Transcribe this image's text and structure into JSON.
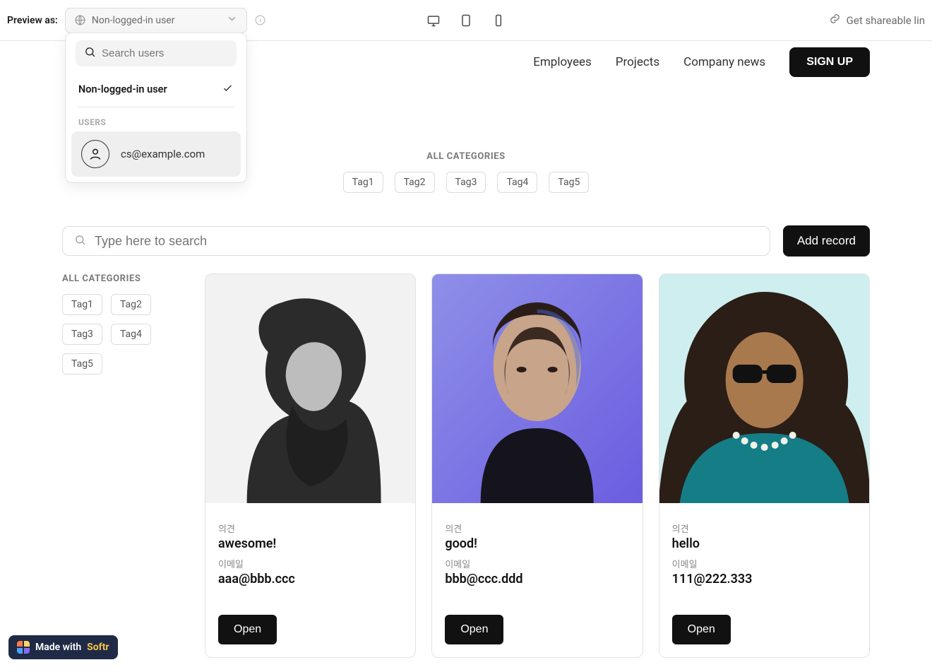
{
  "preview": {
    "label": "Preview as:",
    "selected": "Non-logged-in user",
    "search_placeholder": "Search users",
    "non_logged_label": "Non-logged-in user",
    "users_section": "USERS",
    "user_email": "cs@example.com"
  },
  "share": {
    "label": "Get shareable lin"
  },
  "nav": {
    "employees": "Employees",
    "projects": "Projects",
    "company_news": "Company news",
    "signup": "SIGN UP"
  },
  "hero": {
    "all_categories": "ALL CATEGORIES",
    "tags": {
      "t1": "Tag1",
      "t2": "Tag2",
      "t3": "Tag3",
      "t4": "Tag4",
      "t5": "Tag5"
    }
  },
  "toolbar": {
    "search_placeholder": "Type here to search",
    "add_record": "Add record"
  },
  "side": {
    "all_categories": "ALL CATEGORIES",
    "tags": {
      "t1": "Tag1",
      "t2": "Tag2",
      "t3": "Tag3",
      "t4": "Tag4",
      "t5": "Tag5"
    }
  },
  "cards": {
    "labels": {
      "opinion": "의견",
      "email": "이메일",
      "open": "Open"
    },
    "c1": {
      "opinion": "awesome!",
      "email": "aaa@bbb.ccc"
    },
    "c2": {
      "opinion": "good!",
      "email": "bbb@ccc.ddd"
    },
    "c3": {
      "opinion": "hello",
      "email": "111@222.333"
    }
  },
  "badge": {
    "made": "Made with ",
    "softr": "Softr"
  }
}
